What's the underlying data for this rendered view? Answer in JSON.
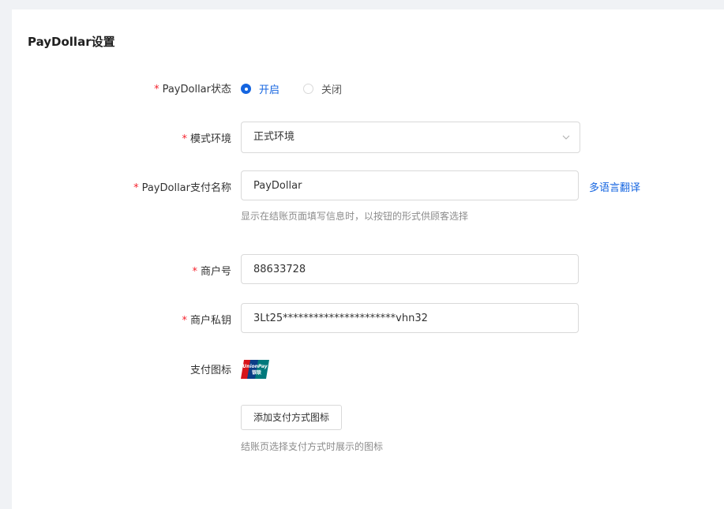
{
  "page": {
    "title": "PayDollar设置"
  },
  "form": {
    "status": {
      "label": "PayDollar状态",
      "options": [
        "开启",
        "关闭"
      ],
      "selected": "开启"
    },
    "mode": {
      "label": "模式环境",
      "value": "正式环境"
    },
    "pay_name": {
      "label": "PayDollar支付名称",
      "value": "PayDollar",
      "translate_link": "多语言翻译",
      "hint": "显示在结账页面填写信息时，以按钮的形式供顾客选择"
    },
    "merchant_id": {
      "label": "商户号",
      "value": "88633728"
    },
    "merchant_key": {
      "label": "商户私钥",
      "value": "3Lt25**********************vhn32"
    },
    "pay_icon": {
      "label": "支付图标",
      "add_button": "添加支付方式图标",
      "hint": "结账页选择支付方式时展示的图标",
      "icon_name": "unionpay-icon"
    }
  },
  "colors": {
    "accent": "#1565e0",
    "required": "#f5222d",
    "unionpay_red": "#d7141a",
    "unionpay_blue": "#0b3e87",
    "unionpay_green": "#00797c"
  }
}
